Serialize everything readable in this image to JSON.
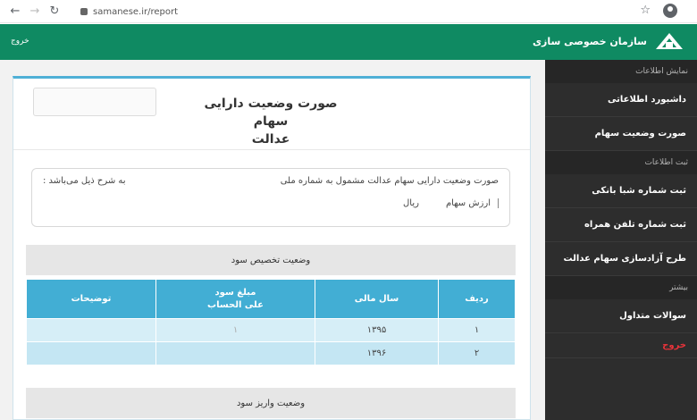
{
  "browser": {
    "url": "samanese.ir/report",
    "back_icon": "arrow-left-icon",
    "forward_icon": "arrow-right-icon",
    "reload_icon": "reload-icon"
  },
  "header": {
    "brand": "سازمان خصوصی سازی",
    "logout": "خروج",
    "color": "#0f8a62"
  },
  "sidebar": {
    "sections": [
      {
        "heading": "نمایش اطلاعات",
        "items": [
          "داشبورد اطلاعاتی",
          "صورت وضعیت سهام"
        ]
      },
      {
        "heading": "ثبت اطلاعات",
        "items": [
          "ثبت شماره شبا بانکی",
          "ثبت شماره تلفن همراه",
          "طرح آزادسازی سهام عدالت"
        ]
      },
      {
        "heading": "بیشتر",
        "items": [
          "سوالات متداول"
        ]
      }
    ],
    "logout": "خروج"
  },
  "report": {
    "title_line1": "صورت وضعیت دارایی سهام",
    "title_line2": "عدالت",
    "info_text": "صورت وضعیت دارایی سهام عدالت مشمول به شماره ملی",
    "info_suffix": "به شرح ذیل می‌باشد :",
    "value_label": "ارزش سهام",
    "currency": "ریال",
    "section1": "وضعیت تخصیص سود",
    "section2": "وضعیت واریز سود",
    "table": {
      "headers": [
        "ردیف",
        "سال مالی",
        "مبلغ سود\nعلی الحساب",
        "توضیحات"
      ],
      "rows": [
        [
          "۱",
          "۱۳۹۵",
          "۱",
          ""
        ],
        [
          "۲",
          "۱۳۹۶",
          "",
          ""
        ]
      ]
    }
  }
}
